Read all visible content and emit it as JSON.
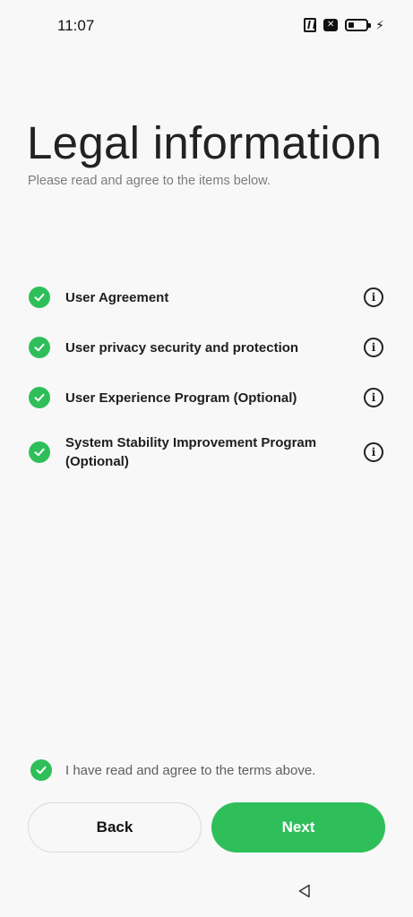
{
  "status_bar": {
    "time": "11:07",
    "icons": [
      "nfc-icon",
      "sim-off-icon",
      "battery-icon",
      "charging-bolt-icon"
    ]
  },
  "header": {
    "title": "Legal information",
    "subtitle": "Please read and agree to the items below."
  },
  "items": [
    {
      "label": "User Agreement",
      "checked": true
    },
    {
      "label": "User privacy security and protection",
      "checked": true
    },
    {
      "label": "User Experience Program (Optional)",
      "checked": true
    },
    {
      "label": "System Stability Improvement Program (Optional)",
      "checked": true
    }
  ],
  "consent": {
    "label": "I have read and agree to the terms above.",
    "checked": true
  },
  "buttons": {
    "back_label": "Back",
    "next_label": "Next"
  },
  "colors": {
    "accent": "#2fbf5a",
    "background": "#f8f8f8"
  }
}
